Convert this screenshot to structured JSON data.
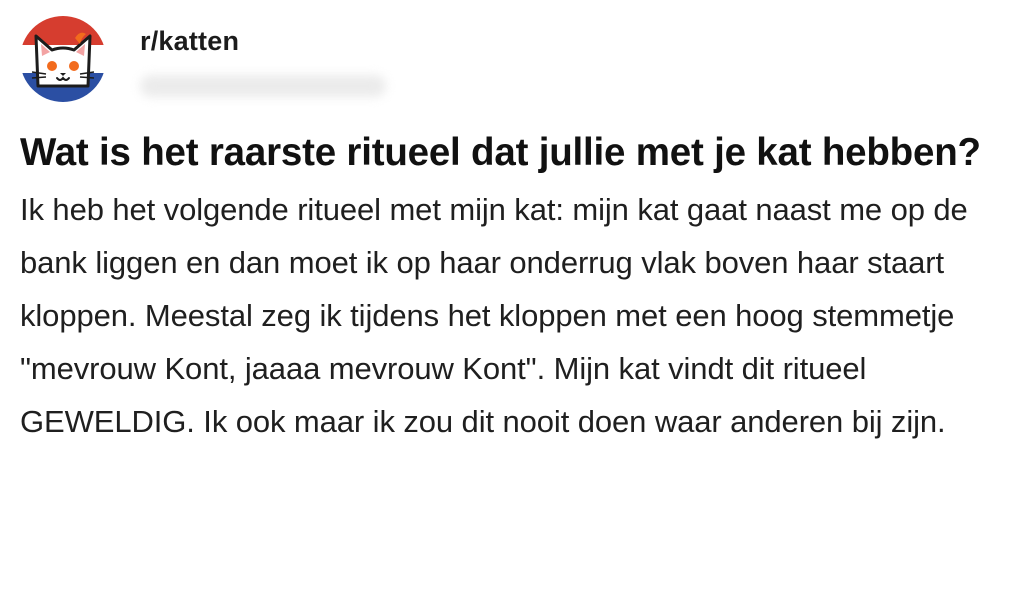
{
  "subreddit": {
    "name": "r/katten",
    "avatar_icon": "cat-face-icon",
    "avatar_colors": {
      "top": "#d63d2f",
      "middle": "#ffffff",
      "bottom": "#2b4fa3"
    }
  },
  "post": {
    "title": "Wat is het raarste ritueel dat jullie met je kat hebben?",
    "body": "Ik heb het volgende ritueel met mijn kat: mijn kat gaat naast me op de bank liggen en dan moet ik op haar onderrug vlak boven haar staart kloppen. Meestal zeg ik tijdens het kloppen met een hoog stemmetje \"mevrouw Kont, jaaaa mevrouw Kont\". Mijn kat vindt dit ritueel GEWELDIG. Ik ook maar ik zou dit nooit doen waar anderen bij zijn."
  }
}
